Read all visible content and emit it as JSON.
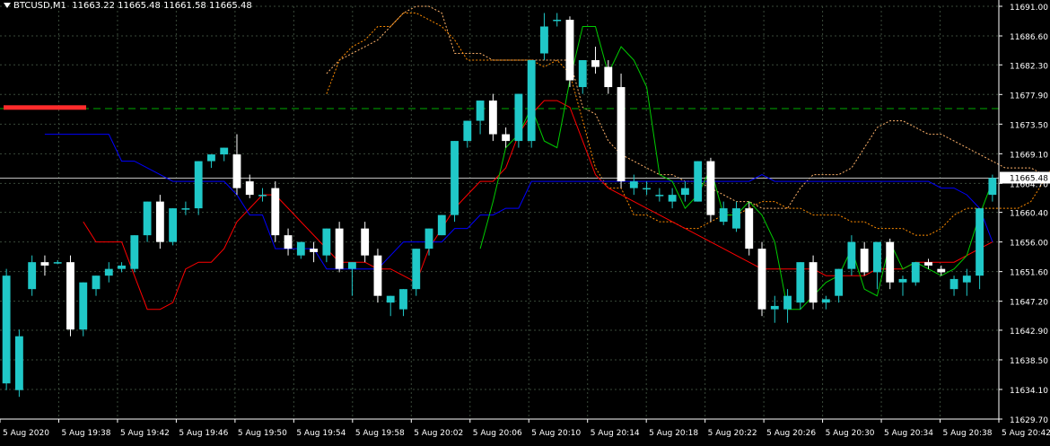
{
  "header": {
    "symbol": "BTCUSD,M1",
    "open": "11663.22",
    "high": "11665.48",
    "low": "11661.58",
    "close": "11665.48"
  },
  "chart_data": {
    "type": "candlestick",
    "symbol": "BTCUSD,M1",
    "current_price": 11665.48,
    "current_price_label": "11665.48",
    "ylim": [
      11629.7,
      11691.0
    ],
    "price_ticks": [
      "11691.00",
      "11686.60",
      "11682.30",
      "11677.90",
      "11673.50",
      "11669.10",
      "11664.70",
      "11660.40",
      "11656.00",
      "11651.60",
      "11647.20",
      "11642.90",
      "11638.50",
      "11634.10",
      "11629.70"
    ],
    "time_ticks": [
      "5 Aug 2020",
      "5 Aug 19:38",
      "5 Aug 19:42",
      "5 Aug 19:46",
      "5 Aug 19:50",
      "5 Aug 19:54",
      "5 Aug 19:58",
      "5 Aug 20:02",
      "5 Aug 20:06",
      "5 Aug 20:10",
      "5 Aug 20:14",
      "5 Aug 20:18",
      "5 Aug 20:22",
      "5 Aug 20:26",
      "5 Aug 20:30",
      "5 Aug 20:34",
      "5 Aug 20:38",
      "5 Aug 20:42"
    ],
    "candles": [
      {
        "o": 11635,
        "h": 11652,
        "l": 11634,
        "c": 11651
      },
      {
        "o": 11634,
        "h": 11643,
        "l": 11633,
        "c": 11642
      },
      {
        "o": 11649,
        "h": 11654,
        "l": 11648,
        "c": 11653
      },
      {
        "o": 11653,
        "h": 11654,
        "l": 11651,
        "c": 11652.5
      },
      {
        "o": 11653,
        "h": 11653.3,
        "l": 11652.7,
        "c": 11653
      },
      {
        "o": 11653,
        "h": 11654,
        "l": 11642,
        "c": 11643
      },
      {
        "o": 11643,
        "h": 11650,
        "l": 11642,
        "c": 11650
      },
      {
        "o": 11649,
        "h": 11651,
        "l": 11648,
        "c": 11651
      },
      {
        "o": 11651,
        "h": 11653,
        "l": 11650,
        "c": 11652
      },
      {
        "o": 11652,
        "h": 11653,
        "l": 11651.5,
        "c": 11652.5
      },
      {
        "o": 11652,
        "h": 11657,
        "l": 11651.5,
        "c": 11657
      },
      {
        "o": 11657,
        "h": 11662,
        "l": 11656,
        "c": 11662
      },
      {
        "o": 11662,
        "h": 11663,
        "l": 11655,
        "c": 11656
      },
      {
        "o": 11656,
        "h": 11661,
        "l": 11655.5,
        "c": 11661
      },
      {
        "o": 11661,
        "h": 11662,
        "l": 11660,
        "c": 11661
      },
      {
        "o": 11661,
        "h": 11668,
        "l": 11660,
        "c": 11668
      },
      {
        "o": 11668,
        "h": 11669,
        "l": 11667,
        "c": 11669
      },
      {
        "o": 11669,
        "h": 11670,
        "l": 11668,
        "c": 11670
      },
      {
        "o": 11669,
        "h": 11672,
        "l": 11663,
        "c": 11664
      },
      {
        "o": 11665,
        "h": 11666,
        "l": 11662.5,
        "c": 11663
      },
      {
        "o": 11663,
        "h": 11664,
        "l": 11662,
        "c": 11663
      },
      {
        "o": 11664,
        "h": 11665,
        "l": 11656,
        "c": 11657
      },
      {
        "o": 11657,
        "h": 11658,
        "l": 11654,
        "c": 11655
      },
      {
        "o": 11654,
        "h": 11656,
        "l": 11653.5,
        "c": 11656
      },
      {
        "o": 11655,
        "h": 11656,
        "l": 11653,
        "c": 11654.5
      },
      {
        "o": 11654,
        "h": 11658,
        "l": 11653,
        "c": 11658
      },
      {
        "o": 11658,
        "h": 11659,
        "l": 11651.5,
        "c": 11652
      },
      {
        "o": 11652,
        "h": 11653,
        "l": 11648,
        "c": 11653
      },
      {
        "o": 11658,
        "h": 11659,
        "l": 11653,
        "c": 11654
      },
      {
        "o": 11654,
        "h": 11655,
        "l": 11647,
        "c": 11648
      },
      {
        "o": 11647,
        "h": 11648,
        "l": 11645,
        "c": 11648
      },
      {
        "o": 11646,
        "h": 11649,
        "l": 11645,
        "c": 11649
      },
      {
        "o": 11649,
        "h": 11655,
        "l": 11648,
        "c": 11655
      },
      {
        "o": 11655,
        "h": 11658,
        "l": 11654,
        "c": 11658
      },
      {
        "o": 11657,
        "h": 11659,
        "l": 11660,
        "c": 11660
      },
      {
        "o": 11660,
        "h": 11671,
        "l": 11659,
        "c": 11671
      },
      {
        "o": 11671,
        "h": 11674,
        "l": 11670,
        "c": 11674
      },
      {
        "o": 11674,
        "h": 11677,
        "l": 11672,
        "c": 11677
      },
      {
        "o": 11677,
        "h": 11678,
        "l": 11671,
        "c": 11672
      },
      {
        "o": 11672,
        "h": 11673,
        "l": 11670,
        "c": 11671
      },
      {
        "o": 11671,
        "h": 11678,
        "l": 11670,
        "c": 11678
      },
      {
        "o": 11671,
        "h": 11682,
        "l": 11670,
        "c": 11683
      },
      {
        "o": 11684,
        "h": 11690,
        "l": 11683,
        "c": 11688
      },
      {
        "o": 11689,
        "h": 11690,
        "l": 11688,
        "c": 11689
      },
      {
        "o": 11689,
        "h": 11689.5,
        "l": 11679,
        "c": 11680
      },
      {
        "o": 11679,
        "h": 11683,
        "l": 11678,
        "c": 11683
      },
      {
        "o": 11683,
        "h": 11685,
        "l": 11681,
        "c": 11682
      },
      {
        "o": 11682,
        "h": 11683,
        "l": 11678,
        "c": 11679
      },
      {
        "o": 11679,
        "h": 11681,
        "l": 11664,
        "c": 11665
      },
      {
        "o": 11664,
        "h": 11666,
        "l": 11663,
        "c": 11665
      },
      {
        "o": 11664,
        "h": 11665,
        "l": 11663,
        "c": 11664
      },
      {
        "o": 11663,
        "h": 11664,
        "l": 11662,
        "c": 11663
      },
      {
        "o": 11662,
        "h": 11664,
        "l": 11661,
        "c": 11663
      },
      {
        "o": 11663,
        "h": 11665,
        "l": 11662,
        "c": 11664
      },
      {
        "o": 11662,
        "h": 11668,
        "l": 11662,
        "c": 11668
      },
      {
        "o": 11668,
        "h": 11668.5,
        "l": 11659,
        "c": 11660
      },
      {
        "o": 11659,
        "h": 11662,
        "l": 11658.5,
        "c": 11661
      },
      {
        "o": 11658,
        "h": 11662,
        "l": 11657.5,
        "c": 11661
      },
      {
        "o": 11661,
        "h": 11662,
        "l": 11654,
        "c": 11655
      },
      {
        "o": 11655,
        "h": 11656,
        "l": 11645,
        "c": 11646
      },
      {
        "o": 11646,
        "h": 11648,
        "l": 11644,
        "c": 11646.5
      },
      {
        "o": 11646,
        "h": 11649,
        "l": 11644,
        "c": 11648
      },
      {
        "o": 11647,
        "h": 11653,
        "l": 11646,
        "c": 11653
      },
      {
        "o": 11653,
        "h": 11654,
        "l": 11646,
        "c": 11647
      },
      {
        "o": 11647,
        "h": 11648,
        "l": 11646,
        "c": 11647.5
      },
      {
        "o": 11648,
        "h": 11652,
        "l": 11647,
        "c": 11652
      },
      {
        "o": 11652,
        "h": 11657,
        "l": 11651,
        "c": 11656
      },
      {
        "o": 11655,
        "h": 11656,
        "l": 11651,
        "c": 11651.5
      },
      {
        "o": 11651.5,
        "h": 11656,
        "l": 11649,
        "c": 11656
      },
      {
        "o": 11656,
        "h": 11656.5,
        "l": 11649,
        "c": 11650
      },
      {
        "o": 11650,
        "h": 11651,
        "l": 11648,
        "c": 11650.5
      },
      {
        "o": 11650,
        "h": 11653,
        "l": 11649.5,
        "c": 11653
      },
      {
        "o": 11653,
        "h": 11653.5,
        "l": 11652,
        "c": 11652.5
      },
      {
        "o": 11652,
        "h": 11652.5,
        "l": 11651,
        "c": 11651.5
      },
      {
        "o": 11649,
        "h": 11651,
        "l": 11648,
        "c": 11650.5
      },
      {
        "o": 11650,
        "h": 11652,
        "l": 11648,
        "c": 11651
      },
      {
        "o": 11651,
        "h": 11661,
        "l": 11649,
        "c": 11661
      },
      {
        "o": 11663,
        "h": 11666,
        "l": 11662,
        "c": 11665.5
      }
    ],
    "series": [
      {
        "type": "tenkan",
        "color": "#ff0000",
        "values": [
          11659,
          11656,
          11656,
          11656,
          11651,
          11646,
          11646,
          11647,
          11652,
          11653,
          11653,
          11655,
          11659,
          11661,
          11663,
          11663,
          11661,
          11659,
          11657,
          11655,
          11653,
          11653,
          11653,
          11652,
          11652,
          11651,
          11650,
          11655,
          11658,
          11661,
          11663,
          11665,
          11665,
          11667,
          11672,
          11675,
          11677,
          11677,
          11676,
          11671,
          11666,
          11664,
          11663,
          11662,
          11661,
          11660,
          11659,
          11658,
          11657,
          11656,
          11655,
          11654,
          11653,
          11652,
          11652,
          11652,
          11652,
          11652,
          11651,
          11651,
          11651,
          11651,
          11652,
          11652,
          11652,
          11653,
          11653,
          11653,
          11653,
          11654,
          11655,
          11656
        ]
      },
      {
        "type": "kijun",
        "color": "#0000ff",
        "values": [
          11672,
          11672,
          11672,
          11672,
          11672,
          11672,
          11668,
          11668,
          11667,
          11666,
          11665,
          11665,
          11665,
          11665,
          11665,
          11663,
          11660,
          11660,
          11655,
          11655,
          11655,
          11655,
          11652,
          11652,
          11652,
          11652,
          11652,
          11654,
          11656,
          11656,
          11656,
          11656,
          11658,
          11658,
          11660,
          11660,
          11661,
          11661,
          11665,
          11665,
          11665,
          11665,
          11665,
          11665,
          11665,
          11665,
          11665,
          11665,
          11665,
          11665,
          11665,
          11665,
          11665,
          11665,
          11665,
          11665,
          11666,
          11665,
          11665,
          11665,
          11665,
          11665,
          11665,
          11665,
          11665,
          11665,
          11665,
          11665,
          11665,
          11665,
          11664,
          11664,
          11663,
          11661,
          11656
        ]
      },
      {
        "type": "chikou",
        "color": "#00cc00",
        "values": [
          11655,
          11662,
          11670,
          11672,
          11676,
          11671,
          11670,
          11680,
          11688,
          11688,
          11681,
          11685,
          11683,
          11679,
          11666,
          11665,
          11661,
          11663,
          11667,
          11660,
          11660,
          11662,
          11660,
          11656,
          11646,
          11646,
          11648,
          11650,
          11651,
          11655,
          11649,
          11648,
          11656,
          11652,
          11653,
          11652,
          11651,
          11652,
          11654,
          11660,
          11665
        ]
      }
    ],
    "cloud": {
      "span_a_color": "#ff8c00",
      "span_b_color": "#ffb36b",
      "span_a": [
        11678,
        11683,
        11685,
        11686,
        11688,
        11688,
        11690,
        11690,
        11689,
        11688,
        11686,
        11683,
        11683,
        11683,
        11683,
        11683,
        11683,
        11682,
        11683,
        11681,
        11674,
        11667,
        11664,
        11664,
        11660,
        11660,
        11659,
        11659,
        11658,
        11658,
        11659,
        11660,
        11660,
        11661,
        11662,
        11662,
        11661,
        11661,
        11660,
        11660,
        11660,
        11659,
        11659,
        11658,
        11658,
        11658,
        11657,
        11657,
        11658,
        11660,
        11661,
        11661,
        11661,
        11661,
        11661,
        11662,
        11665,
        11668,
        11670,
        11670,
        11670,
        11670,
        11669
      ],
      "span_b": [
        11681,
        11683,
        11684,
        11685,
        11686,
        11688,
        11690,
        11691,
        11691,
        11690,
        11684,
        11684,
        11684,
        11683,
        11683,
        11683,
        11683,
        11683,
        11683,
        11683,
        11676,
        11675,
        11671,
        11669,
        11668,
        11667,
        11666,
        11666,
        11665,
        11665,
        11664,
        11663,
        11662,
        11662,
        11661,
        11661,
        11661,
        11664,
        11666,
        11666,
        11666,
        11667,
        11670,
        11673,
        11674,
        11674,
        11673,
        11672,
        11672,
        11671,
        11670,
        11669,
        11668,
        11667,
        11667,
        11667,
        11666,
        11664,
        11663,
        11661,
        11660,
        11660,
        11660
      ]
    },
    "horizontal_lines": [
      {
        "value": 11675.8,
        "color": "#00aa00",
        "style": "dashed"
      },
      {
        "value": 11665.48,
        "color": "#c0c0c0",
        "style": "solid"
      }
    ],
    "grid": true,
    "colors": {
      "bull": "#20c8c8",
      "bear": "#ffffff",
      "background": "#000000",
      "grid": "#3a4a3a",
      "axis": "#ffffff",
      "psar": "#00ff00"
    }
  }
}
